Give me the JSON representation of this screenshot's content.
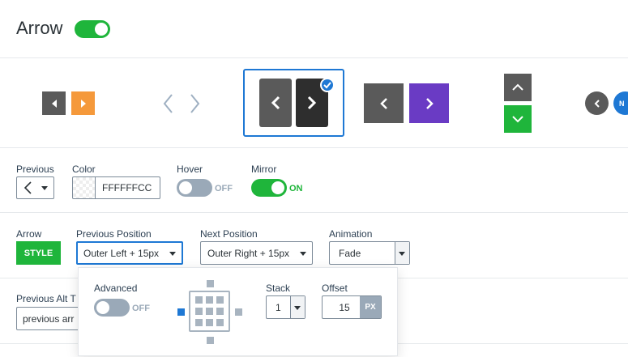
{
  "header": {
    "title": "Arrow",
    "enabled": true
  },
  "styles": {
    "selected_index": 2,
    "icons": [
      "chevron-left-icon",
      "chevron-right-icon",
      "chevron-up-icon",
      "chevron-down-icon",
      "checkmark-icon"
    ],
    "partial_badge": "N"
  },
  "row1": {
    "previous_label": "Previous",
    "previous_value": "‹",
    "color_label": "Color",
    "color_value": "FFFFFFCC",
    "hover_label": "Hover",
    "hover_state": "OFF",
    "mirror_label": "Mirror",
    "mirror_state": "ON"
  },
  "row2": {
    "arrow_label": "Arrow",
    "style_button": "STYLE",
    "prev_pos_label": "Previous Position",
    "prev_pos_value": "Outer Left + 15px",
    "next_pos_label": "Next Position",
    "next_pos_value": "Outer Right + 15px",
    "animation_label": "Animation",
    "animation_value": "Fade"
  },
  "row3": {
    "prev_alt_label": "Previous Alt T",
    "prev_alt_value": "previous arr"
  },
  "popup": {
    "advanced_label": "Advanced",
    "advanced_state": "OFF",
    "stack_label": "Stack",
    "stack_value": "1",
    "offset_label": "Offset",
    "offset_value": "15",
    "offset_unit": "PX"
  },
  "colors": {
    "green": "#1fb53b",
    "blue": "#1e78d4",
    "orange": "#f5993b",
    "purple": "#6a3bc4",
    "dark": "#5a5a5a"
  }
}
